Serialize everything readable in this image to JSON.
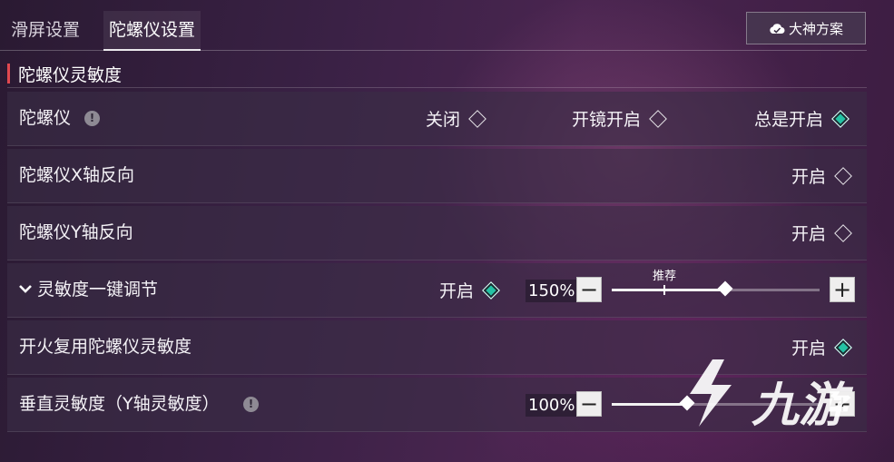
{
  "tabs": [
    {
      "label": "滑屏设置",
      "active": false
    },
    {
      "label": "陀螺仪设置",
      "active": true
    }
  ],
  "preset_button": {
    "label": "大神方案",
    "icon": "cloud-icon"
  },
  "section": {
    "title": "陀螺仪灵敏度",
    "accent": "#e0484f"
  },
  "rows": {
    "gyro": {
      "label": "陀螺仪",
      "info_icon": "!",
      "options": [
        {
          "label": "关闭",
          "selected": false
        },
        {
          "label": "开镜开启",
          "selected": false
        },
        {
          "label": "总是开启",
          "selected": true
        }
      ]
    },
    "x_invert": {
      "label": "陀螺仪X轴反向",
      "option_label": "开启",
      "selected": false
    },
    "y_invert": {
      "label": "陀螺仪Y轴反向",
      "option_label": "开启",
      "selected": false
    },
    "one_key": {
      "label": "灵敏度一键调节",
      "option_label": "开启",
      "selected": true,
      "value_text": "150%",
      "value": 150,
      "recommended_label": "推荐",
      "minus": "−",
      "plus": "+"
    },
    "fire_reuse": {
      "label": "开火复用陀螺仪灵敏度",
      "option_label": "开启",
      "selected": true
    },
    "vertical": {
      "label": "垂直灵敏度（Y轴灵敏度）",
      "info_icon": "!",
      "value_text": "100%",
      "value": 100,
      "minus": "−",
      "plus": "+"
    }
  },
  "watermark": {
    "text": "九游"
  },
  "colors": {
    "selected_diamond": "#24c2a4",
    "accent": "#e0484f"
  }
}
